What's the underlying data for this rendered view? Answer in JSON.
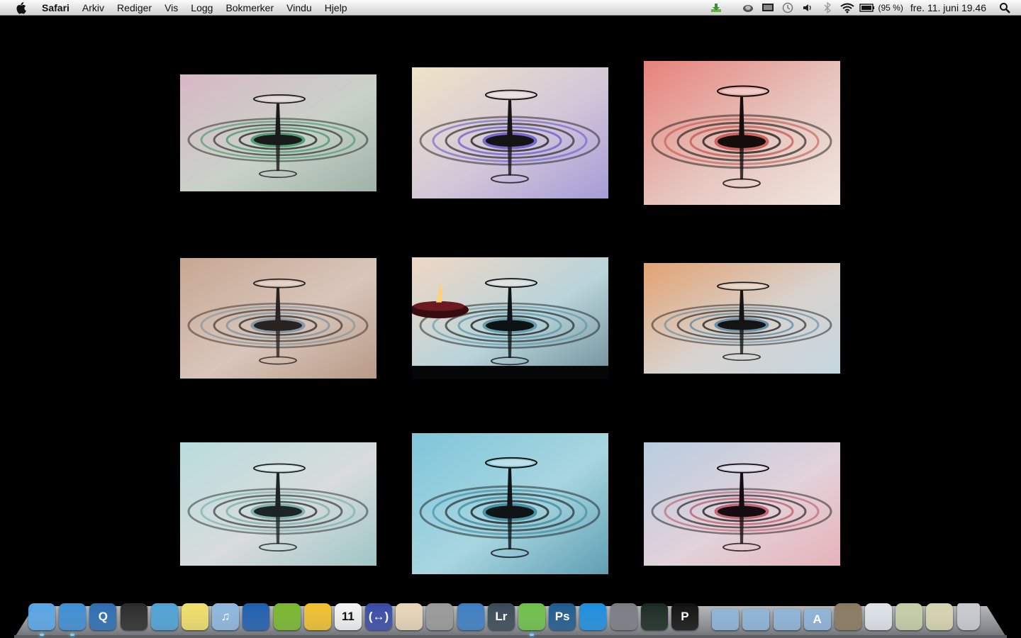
{
  "menubar": {
    "apple_icon": "apple-icon",
    "app_name": "Safari",
    "items": [
      "Arkiv",
      "Rediger",
      "Vis",
      "Logg",
      "Bokmerker",
      "Vindu",
      "Hjelp"
    ],
    "status_icons": [
      "download-icon",
      "eject-icon",
      "display-icon",
      "time-machine-icon",
      "volume-icon",
      "bluetooth-icon",
      "wifi-icon",
      "battery-icon"
    ],
    "battery_percent": "(95 %)",
    "clock": "fre. 11. juni  19.46",
    "spotlight_icon": "spotlight-search-icon"
  },
  "photos": [
    {
      "name": "photo-drop-1",
      "colors": [
        "#d8b8c6",
        "#c9d2c8",
        "#9fb3a8"
      ],
      "ring": "#1a1a1a",
      "accent": "#2f8f5f"
    },
    {
      "name": "photo-drop-2",
      "colors": [
        "#efe3c6",
        "#d3c7d9",
        "#a69cd8"
      ],
      "ring": "#141414",
      "accent": "#5a4fc8"
    },
    {
      "name": "photo-drop-3",
      "colors": [
        "#e7827a",
        "#e6c6bf",
        "#f0e6df"
      ],
      "ring": "#150d0c",
      "accent": "#c04a45"
    },
    {
      "name": "photo-drop-4",
      "colors": [
        "#c7a792",
        "#d8c6bb",
        "#b89a86"
      ],
      "ring": "#2a2220",
      "accent": "#6f8fa0"
    },
    {
      "name": "photo-drop-5-candle",
      "colors": [
        "#f0d7c4",
        "#b9d4da",
        "#6f8f9a"
      ],
      "ring": "#0d1214",
      "accent": "#4e8ea0"
    },
    {
      "name": "photo-drop-6",
      "colors": [
        "#e3a272",
        "#d8d3cf",
        "#c4d6df"
      ],
      "ring": "#141414",
      "accent": "#4b7fa0"
    },
    {
      "name": "photo-drop-7",
      "colors": [
        "#b9dcdc",
        "#d8dcdc",
        "#9fc6c6"
      ],
      "ring": "#1c2424",
      "accent": "#6aa5a5"
    },
    {
      "name": "photo-drop-8",
      "colors": [
        "#7fc6da",
        "#a8d6e0",
        "#5f9fb3"
      ],
      "ring": "#0f1416",
      "accent": "#2f7f95"
    },
    {
      "name": "photo-drop-9",
      "colors": [
        "#b8cde0",
        "#e2d2da",
        "#e7b3b8"
      ],
      "ring": "#140c10",
      "accent": "#b84a5a"
    }
  ],
  "dock": [
    {
      "name": "finder-icon",
      "label": "",
      "bg": "#5aa7e8",
      "running": true
    },
    {
      "name": "safari-icon",
      "label": "",
      "bg": "#3f8fd6",
      "running": true
    },
    {
      "name": "quicktime-icon",
      "label": "Q",
      "bg": "#2d6fb3",
      "running": false
    },
    {
      "name": "clapper-icon",
      "label": "",
      "bg": "#2b2b2b",
      "running": false
    },
    {
      "name": "messenger-icon",
      "label": "",
      "bg": "#4fa3d8",
      "running": false
    },
    {
      "name": "stickies-icon",
      "label": "",
      "bg": "#f1e06a",
      "running": false
    },
    {
      "name": "itunes-icon",
      "label": "♫",
      "bg": "#8fb8e0",
      "running": false
    },
    {
      "name": "google-earth-icon",
      "label": "",
      "bg": "#1f5fb0",
      "running": false
    },
    {
      "name": "spotify-icon",
      "label": "",
      "bg": "#7ab82f",
      "running": false
    },
    {
      "name": "yahoo-messenger-icon",
      "label": "",
      "bg": "#f2c12e",
      "running": false
    },
    {
      "name": "ical-icon",
      "label": "11",
      "bg": "#f4f4f4",
      "running": false
    },
    {
      "name": "arrows-app-icon",
      "label": "(↔)",
      "bg": "#3a4ca8",
      "running": false
    },
    {
      "name": "popcorn-icon",
      "label": "",
      "bg": "#e8d7b8",
      "running": false
    },
    {
      "name": "calculator-icon",
      "label": "",
      "bg": "#9a9a9a",
      "running": false
    },
    {
      "name": "office-icon",
      "label": "",
      "bg": "#3d7fc4",
      "running": false
    },
    {
      "name": "lightroom-icon",
      "label": "Lr",
      "bg": "#3b4a58",
      "running": false
    },
    {
      "name": "remote-icon",
      "label": "",
      "bg": "#6fc24a",
      "running": true
    },
    {
      "name": "photoshop-icon",
      "label": "Ps",
      "bg": "#1f5c8f",
      "running": false
    },
    {
      "name": "teamviewer-icon",
      "label": "",
      "bg": "#1d8fe0",
      "running": false
    },
    {
      "name": "system-preferences-icon",
      "label": "",
      "bg": "#7b7f85",
      "running": false
    },
    {
      "name": "activity-monitor-icon",
      "label": "",
      "bg": "#1b2a22",
      "running": false
    },
    {
      "name": "p-app-icon",
      "label": "P",
      "bg": "#111111",
      "running": false
    },
    {
      "name": "folder-icon",
      "label": "",
      "bg": "#8fb5d9",
      "running": false
    },
    {
      "name": "folder-icon",
      "label": "",
      "bg": "#8fb5d9",
      "running": false
    },
    {
      "name": "folder-icon",
      "label": "",
      "bg": "#8fb5d9",
      "running": false
    },
    {
      "name": "applications-folder-icon",
      "label": "A",
      "bg": "#8fb5d9",
      "running": false
    },
    {
      "name": "document-stack-icon",
      "label": "",
      "bg": "#8a7a60",
      "running": false
    },
    {
      "name": "document-stack-icon",
      "label": "",
      "bg": "#dfe4ea",
      "running": false
    },
    {
      "name": "document-stack-icon",
      "label": "",
      "bg": "#c7cfa8",
      "running": false
    },
    {
      "name": "document-stack-icon",
      "label": "",
      "bg": "#d8d6b0",
      "running": false
    },
    {
      "name": "trash-icon",
      "label": "",
      "bg": "#c9ccd0",
      "running": false
    }
  ]
}
